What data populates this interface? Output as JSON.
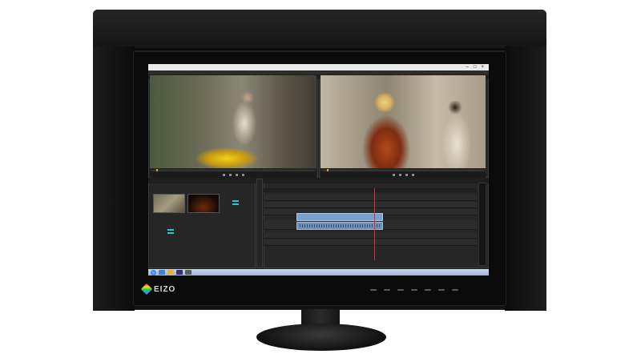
{
  "brand": {
    "logo_text": "EIZO"
  },
  "colors": {
    "timecode": "#e3a21a",
    "playhead": "#e0302a",
    "clip_video": "#7a9fc8",
    "taskbar": "#c6d7ea"
  },
  "icons": [
    "eizo-logo-icon",
    "windows-start-icon",
    "play-icon",
    "sequence-icon"
  ]
}
